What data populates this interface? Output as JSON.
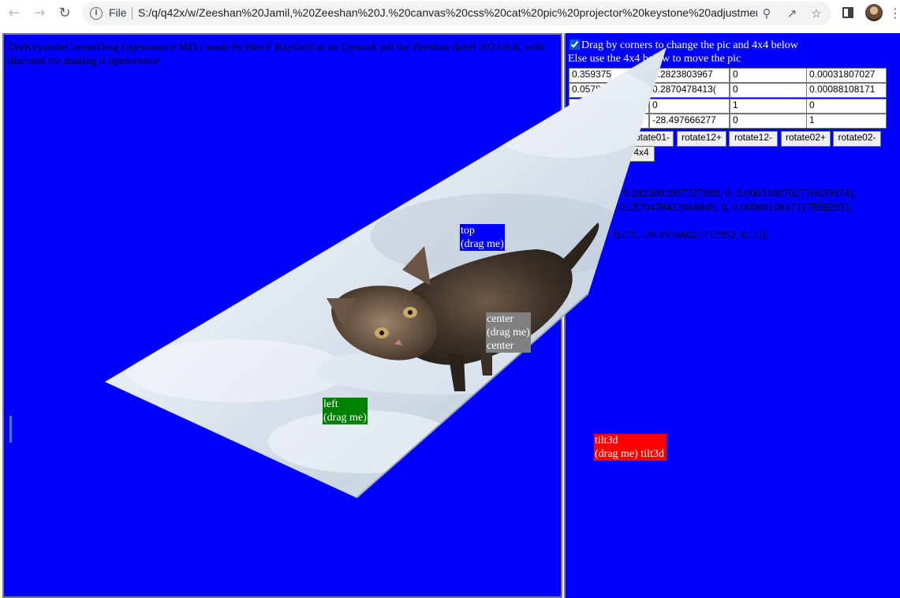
{
  "browser": {
    "scheme": "File",
    "url": "S:/q/q42x/w/Zeeshan%20Jamil,%20Zeeshan%20J.%20canvas%20css%20cat%20pic%20projector%20keystone%20adjustmen..."
  },
  "page": {
    "title": "DivKeystoneCornerDrag (opensource MIT) made by Ben F Rayfield as an Upwork job for Zeeshan Jamil 2022-8-8, with discount for making it opensource",
    "handles": {
      "top": "top\n(drag me)",
      "center": "center\n(drag me)\ncenter",
      "left": "left\n(drag me)",
      "tilt": "tilt3d\n(drag me) tilt3d"
    },
    "controls": {
      "drag_label": "Drag by corners to change the pic and 4x4 below",
      "drag_checked": true,
      "else_label": "Else use the 4x4 below to move the pic",
      "matrix": [
        [
          "0.359375",
          "0.2823803967",
          "0",
          "0.00031807027"
        ],
        [
          "0.0578",
          "0.2870478413(",
          "0",
          "0.00088108171"
        ],
        [
          "",
          "0",
          "1",
          "0"
        ],
        [
          "",
          "-28.497666277",
          "0",
          "1"
        ]
      ],
      "rotate_buttons": [
        "rotate01-",
        "rotate12+",
        "rotate12-",
        "rotate02+",
        "rotate02-"
      ],
      "last_button": "4x4",
      "matrix_text": [
        "0.2823803967327888, 0, 0.0003180702716639974],",
        ", 0.2870478413068845, 0, 0.0008810817117859295],",
        "9375, -28.49766627712952, 0, 1]];"
      ]
    },
    "colors": {
      "pane_bg": "#0000ff",
      "handle_top": "#0000ff",
      "handle_center": "#808080",
      "handle_left": "#008000",
      "handle_tilt": "#ff0000"
    }
  }
}
